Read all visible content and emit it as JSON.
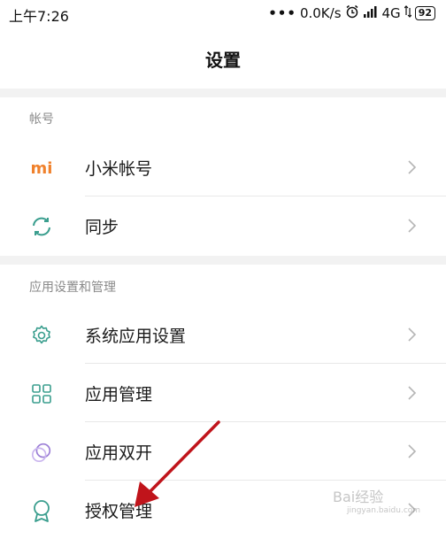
{
  "status_bar": {
    "time": "上午7:26",
    "dots": "•••",
    "net_speed": "0.0K/s",
    "network": "4G",
    "battery": "92"
  },
  "header": {
    "title": "设置"
  },
  "sections": [
    {
      "header": "帐号",
      "items": [
        {
          "label": "小米帐号",
          "icon": "mi-logo-icon"
        },
        {
          "label": "同步",
          "icon": "sync-icon"
        }
      ]
    },
    {
      "header": "应用设置和管理",
      "items": [
        {
          "label": "系统应用设置",
          "icon": "gear-icon"
        },
        {
          "label": "应用管理",
          "icon": "grid-icon"
        },
        {
          "label": "应用双开",
          "icon": "dual-circle-icon"
        },
        {
          "label": "授权管理",
          "icon": "ribbon-icon"
        }
      ]
    }
  ],
  "mi_logo_text": "mi",
  "watermark": {
    "text": "Bai经验",
    "url": "jingyan.baidu.com"
  },
  "colors": {
    "accent_icon": "#3a9e8e",
    "mi_orange": "#f0812c",
    "arrow_red": "#c0141b"
  }
}
